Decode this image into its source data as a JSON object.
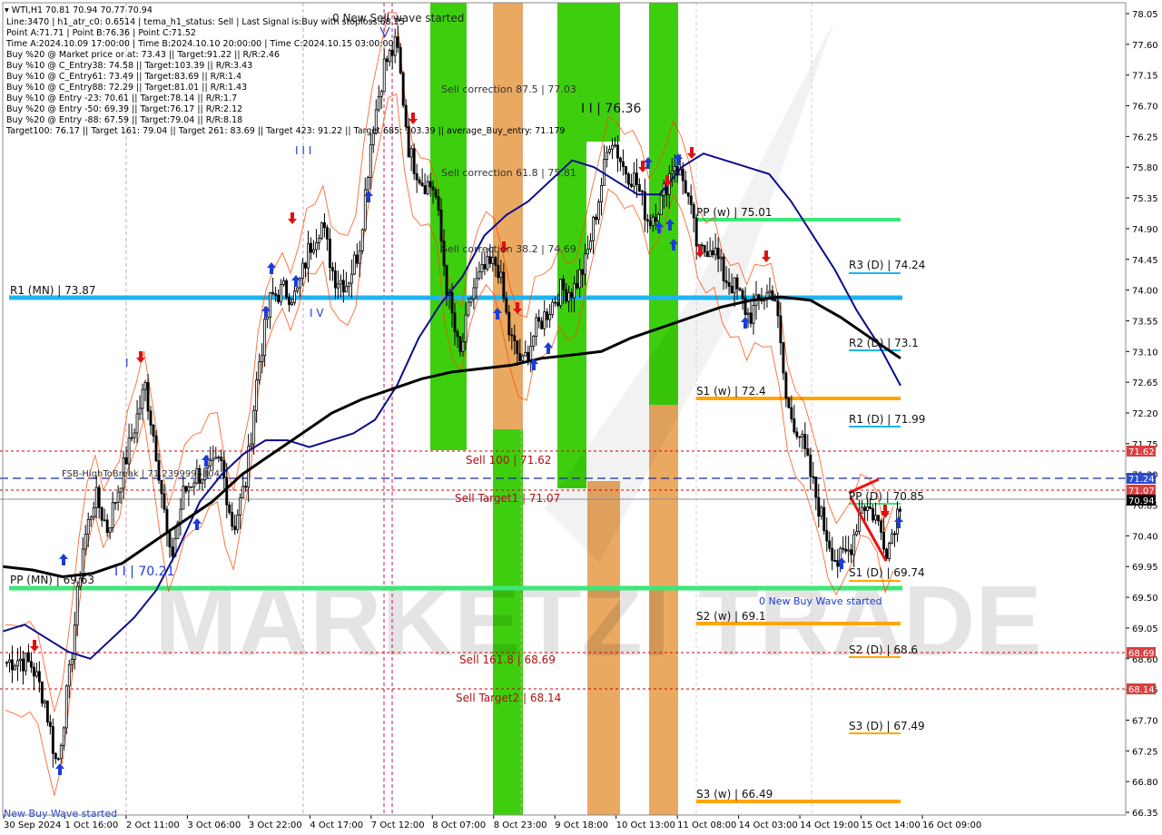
{
  "header": {
    "symbol": "WTI,H1  70.81 70.94 70.77 70.94",
    "lines": [
      "Line:3470  |  h1_atr_c0: 0.6514  |  tema_h1_status: Sell  |  Last Signal is:Buy with stoploss:68.25",
      "Point A:71.71  |  Point B:76.36  |  Point C:71.52",
      "Time A:2024.10.09 17:00:00  |  Time B:2024.10.10 20:00:00  |  Time C:2024.10.15 03:00:00",
      "Buy %20 @ Market price or at: 73.43  ||  Target:91.22  ||  R/R:2.46",
      "Buy %10 @ C_Entry38: 74.58  ||  Target:103.39  ||  R/R:3.43",
      "Buy %10 @ C_Entry61: 73.49  ||  Target:83.69  ||  R/R:1.4",
      "Buy %10 @ C_Entry88: 72.29  ||  Target:81.01  ||  R/R:1.43",
      "Buy %10 @ Entry -23: 70.61  ||  Target:78.14  ||  R/R:1.7",
      "Buy %20 @ Entry -50: 69.39  ||  Target:76.17  ||  R/R:2.12",
      "Buy %20 @ Entry -88: 67.59  ||  Target:79.04  ||  R/R:8.18",
      "Target100: 76.17  ||  Target 161: 79.04  ||  Target 261: 83.69  ||  Target 423: 91.22  ||  Target 685: 103.39  ||  average_Buy_entry: 71.179"
    ]
  },
  "colors": {
    "background": "#ffffff",
    "candle": "#000000",
    "blue_ma": "#0c0c8c",
    "black_ma": "#000000",
    "band": "#ff4500",
    "green": "#33cc00",
    "orange": "#e8a050",
    "pivot_cyan": "#1eb4f0",
    "pivot_green": "#3ce878",
    "pivot_orange": "#ffa500",
    "sell_red": "#cc0000",
    "dashed_blue": "#1a2a9c",
    "arrow_up": "#1c3cd8",
    "arrow_down": "#e01010"
  },
  "chart_data": {
    "type": "candlestick",
    "ylim": [
      66.35,
      78.05
    ],
    "y_ticks": [
      "78.05",
      "77.60",
      "77.15",
      "76.70",
      "76.25",
      "75.80",
      "75.35",
      "74.90",
      "74.45",
      "74.00",
      "73.55",
      "73.10",
      "72.65",
      "72.20",
      "71.75",
      "71.30",
      "70.85",
      "70.40",
      "69.95",
      "69.50",
      "69.05",
      "68.60",
      "68.15",
      "67.70",
      "67.25",
      "66.80",
      "66.35"
    ],
    "x_ticks": [
      "30 Sep 2024",
      "1 Oct 16:00",
      "2 Oct 11:00",
      "3 Oct 06:00",
      "3 Oct 22:00",
      "4 Oct 17:00",
      "7 Oct 12:00",
      "8 Oct 07:00",
      "8 Oct 23:00",
      "9 Oct 18:00",
      "10 Oct 13:00",
      "11 Oct 08:00",
      "14 Oct 03:00",
      "14 Oct 19:00",
      "15 Oct 14:00",
      "16 Oct 09:00"
    ],
    "price_path": [
      68.55,
      68.6,
      68.5,
      68.0,
      67.0,
      68.4,
      70.2,
      71.0,
      70.5,
      71.2,
      71.9,
      72.6,
      71.5,
      70.0,
      71.0,
      71.3,
      71.3,
      71.5,
      70.5,
      71.2,
      72.9,
      73.9,
      74.0,
      73.9,
      74.6,
      75.0,
      74.2,
      74.1,
      74.6,
      76.3,
      77.3,
      77.6,
      76.0,
      75.6,
      75.5,
      74.0,
      73.0,
      74.0,
      74.3,
      74.4,
      73.3,
      72.9,
      73.4,
      73.7,
      74.0,
      74.0,
      74.4,
      75.3,
      76.3,
      75.8,
      75.6,
      75.0,
      75.3,
      75.9,
      75.5,
      74.5,
      74.7,
      74.2,
      74.0,
      73.6,
      73.9,
      74.0,
      72.3,
      71.9,
      71.2,
      70.5,
      70.0,
      70.2,
      70.9,
      70.7,
      70.2,
      70.9
    ],
    "series": [
      {
        "name": "",
        "values": [
          69.0,
          69.1,
          68.9,
          68.7,
          68.6,
          68.9,
          69.2,
          69.6,
          70.2,
          70.9,
          71.3,
          71.6,
          71.8,
          71.8,
          71.7,
          71.8,
          71.9,
          72.1,
          72.6,
          73.3,
          73.8,
          74.2,
          74.8,
          75.1,
          75.3,
          75.6,
          75.9,
          75.8,
          75.6,
          75.4,
          75.4,
          75.8,
          76.0,
          75.9,
          75.8,
          75.7,
          75.3,
          74.8,
          74.3,
          73.7,
          73.2,
          72.6
        ]
      },
      {
        "name": "",
        "values": [
          69.95,
          69.9,
          69.8,
          69.85,
          70.0,
          70.3,
          70.6,
          70.9,
          71.3,
          71.6,
          71.9,
          72.2,
          72.4,
          72.55,
          72.7,
          72.8,
          72.85,
          72.9,
          73.0,
          73.05,
          73.1,
          73.3,
          73.45,
          73.6,
          73.75,
          73.85,
          73.9,
          73.85,
          73.6,
          73.3,
          73.0
        ]
      }
    ]
  },
  "levels": {
    "r1_mn": "R1 (MN) | 73.87",
    "pp_mn": "PP (MN) | 69.63",
    "pp_w": "PP (w) | 75.01",
    "s1_w": "S1 (w) | 72.4",
    "s2_w": "S2 (w) | 69.1",
    "s3_w": "S3 (w) | 66.49",
    "r3_d": "R3 (D) | 74.24",
    "r2_d": "R2 (D) | 73.1",
    "r1_d": "R1 (D) | 71.99",
    "pp_d": "PP (D) | 70.85",
    "s1_d": "S1 (D) | 69.74",
    "s2_d": "S2 (D) | 68.6",
    "s3_d": "S3 (D) | 67.49"
  },
  "annotations": {
    "sell_wave": "0 New Sell wave started",
    "buy_wave": "0 New Buy Wave started",
    "buy_wave_left": "New Buy Wave started",
    "correction_875": "Sell correction 87.5 | 77.03",
    "correction_618": "Sell correction 61.8 | 75.81",
    "correction_382": "Sell correction 38.2 | 74.69",
    "point_b": "I I | 76.36",
    "point_a": "I I | 70.21",
    "sell_100": "Sell 100 | 71.62",
    "sell_target1": "Sell Target1 | 71.07",
    "sell_161": "Sell 161.8 | 68.69",
    "sell_target2": "Sell Target2 | 68.14",
    "fsb": "FSB-HighToBreak | 71.2399995804",
    "iv": "I V",
    "iii": "I I I",
    "i_mark": "I",
    "watermark": "MARKETZI TRADE"
  },
  "price_badges": {
    "sell100": "71.62",
    "fsb": "71.24",
    "target1": "71.07",
    "current": "70.94",
    "sell161": "68.69",
    "target2": "68.14"
  }
}
